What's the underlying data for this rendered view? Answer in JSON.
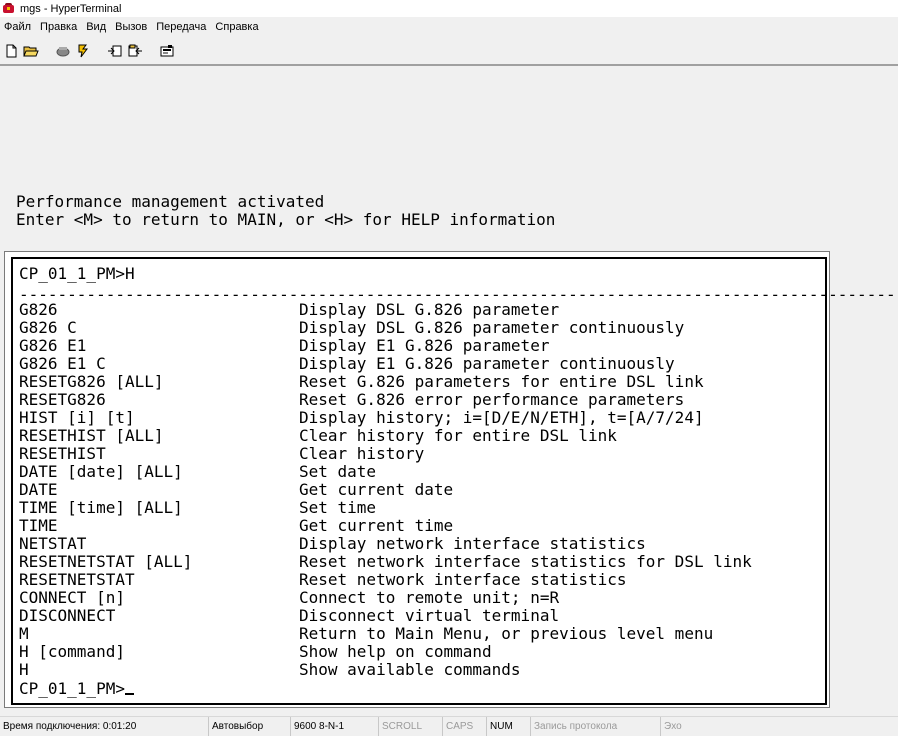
{
  "window": {
    "title": "mgs - HyperTerminal"
  },
  "menu": {
    "items": [
      "Файл",
      "Правка",
      "Вид",
      "Вызов",
      "Передача",
      "Справка"
    ]
  },
  "toolbar": {
    "icons": [
      "new-file-icon",
      "open-folder-icon",
      "call-icon",
      "disconnect-icon",
      "send-file-icon",
      "receive-file-icon",
      "properties-icon"
    ]
  },
  "terminal": {
    "pre_lines": [
      "Performance management activated",
      "Enter <M> to return to MAIN, or <H> for HELP information"
    ],
    "prompt_command": "CP_01_1_PM>H",
    "separator": "-----------------------------------------------------------------------------------------------",
    "commands": [
      {
        "cmd": "G826",
        "desc": "Display DSL G.826 parameter"
      },
      {
        "cmd": "G826 C",
        "desc": "Display DSL G.826 parameter continuously"
      },
      {
        "cmd": "G826 E1",
        "desc": "Display E1 G.826 parameter"
      },
      {
        "cmd": "G826 E1 C",
        "desc": "Display E1 G.826 parameter continuously"
      },
      {
        "cmd": "RESETG826 [ALL]",
        "desc": "Reset G.826 parameters for entire DSL link"
      },
      {
        "cmd": "RESETG826",
        "desc": "Reset G.826 error performance parameters"
      },
      {
        "cmd": "HIST [i] [t]",
        "desc": "Display history; i=[D/E/N/ETH], t=[A/7/24]"
      },
      {
        "cmd": "RESETHIST [ALL]",
        "desc": "Clear history for entire DSL link"
      },
      {
        "cmd": "RESETHIST",
        "desc": "Clear history"
      },
      {
        "cmd": "DATE [date] [ALL]",
        "desc": "Set date"
      },
      {
        "cmd": "DATE",
        "desc": "Get current date"
      },
      {
        "cmd": "TIME [time] [ALL]",
        "desc": "Set time"
      },
      {
        "cmd": "TIME",
        "desc": "Get current time"
      },
      {
        "cmd": "NETSTAT",
        "desc": "Display network interface statistics"
      },
      {
        "cmd": "RESETNETSTAT [ALL]",
        "desc": "Reset network interface statistics for DSL link"
      },
      {
        "cmd": "RESETNETSTAT",
        "desc": "Reset network interface statistics"
      },
      {
        "cmd": "CONNECT [n]",
        "desc": "Connect to remote unit; n=R"
      },
      {
        "cmd": "DISCONNECT",
        "desc": "Disconnect virtual terminal"
      },
      {
        "cmd": "M",
        "desc": "Return to Main Menu, or previous level menu"
      },
      {
        "cmd": "H [command]",
        "desc": "Show help on command"
      },
      {
        "cmd": "H",
        "desc": "Show available commands"
      }
    ],
    "current_prompt": "CP_01_1_PM>"
  },
  "statusbar": {
    "connection_time": "Время подключения: 0:01:20",
    "detect": "Автовыбор",
    "params": "9600 8-N-1",
    "scroll": "SCROLL",
    "caps": "CAPS",
    "num": "NUM",
    "capture": "Запись протокола",
    "echo": "Эхо"
  }
}
